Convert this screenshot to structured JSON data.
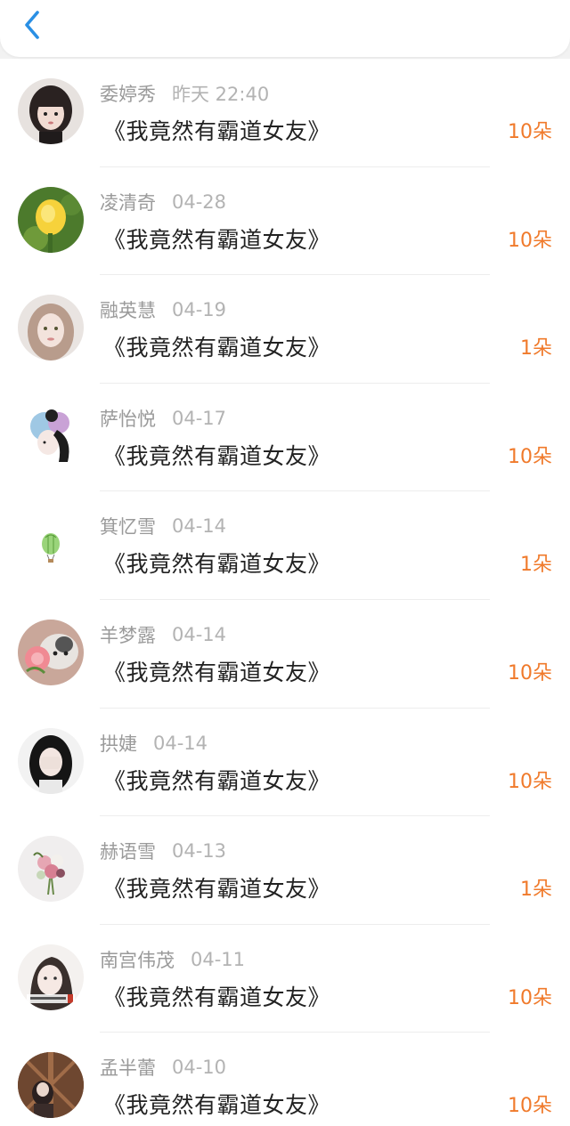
{
  "header": {
    "back_icon": "chevron-left-icon",
    "accent_color": "#2a8fe4"
  },
  "gift_color": "#f07a2b",
  "items": [
    {
      "name": "委婷秀",
      "time": "昨天 22:40",
      "book": "《我竟然有霸道女友》",
      "gift": "10朵",
      "avatar": "girl-portrait"
    },
    {
      "name": "凌清奇",
      "time": "04-28",
      "book": "《我竟然有霸道女友》",
      "gift": "10朵",
      "avatar": "yellow-flower"
    },
    {
      "name": "融英慧",
      "time": "04-19",
      "book": "《我竟然有霸道女友》",
      "gift": "1朵",
      "avatar": "girl-light-hair"
    },
    {
      "name": "萨怡悦",
      "time": "04-17",
      "book": "《我竟然有霸道女友》",
      "gift": "10朵",
      "avatar": "illustrated-girl"
    },
    {
      "name": "箕忆雪",
      "time": "04-14",
      "book": "《我竟然有霸道女友》",
      "gift": "1朵",
      "avatar": "hot-air-balloon"
    },
    {
      "name": "羊梦露",
      "time": "04-14",
      "book": "《我竟然有霸道女友》",
      "gift": "10朵",
      "avatar": "cat-with-flower"
    },
    {
      "name": "拱婕",
      "time": "04-14",
      "book": "《我竟然有霸道女友》",
      "gift": "10朵",
      "avatar": "girl-covering-face"
    },
    {
      "name": "赫语雪",
      "time": "04-13",
      "book": "《我竟然有霸道女友》",
      "gift": "1朵",
      "avatar": "flower-bouquet"
    },
    {
      "name": "南宫伟茂",
      "time": "04-11",
      "book": "《我竟然有霸道女友》",
      "gift": "10朵",
      "avatar": "girl-with-caption"
    },
    {
      "name": "孟半蕾",
      "time": "04-10",
      "book": "《我竟然有霸道女友》",
      "gift": "10朵",
      "avatar": "girl-wooden-door"
    }
  ]
}
